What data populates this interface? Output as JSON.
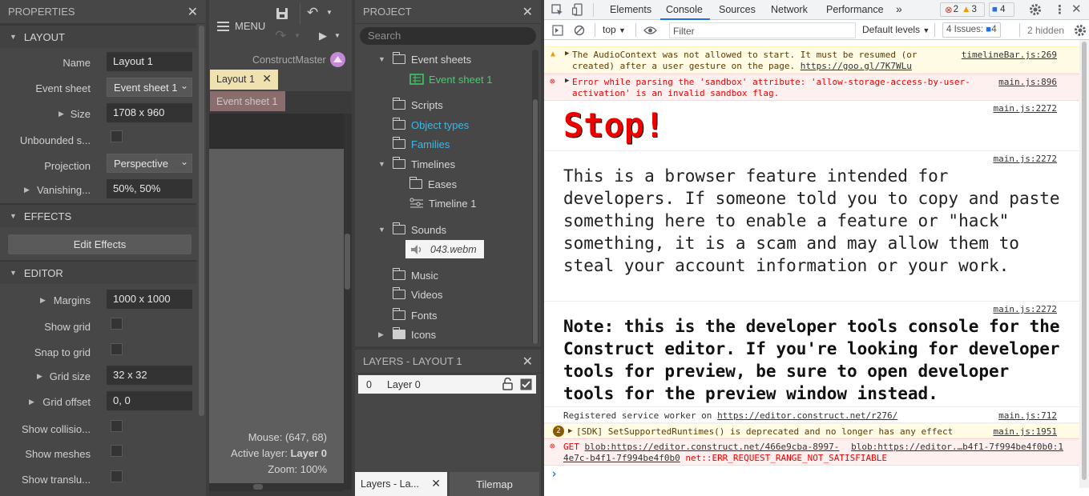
{
  "properties": {
    "title": "PROPERTIES",
    "sections": {
      "layout": "LAYOUT",
      "effects": "EFFECTS",
      "editor": "EDITOR"
    },
    "rows": {
      "name_label": "Name",
      "name_value": "Layout 1",
      "eventsheet_label": "Event sheet",
      "eventsheet_value": "Event sheet 1",
      "size_label": "Size",
      "size_value": "1708 x 960",
      "unbounded_label": "Unbounded s...",
      "projection_label": "Projection",
      "projection_value": "Perspective",
      "vanishing_label": "Vanishing...",
      "vanishing_value": "50%, 50%",
      "edit_effects": "Edit Effects",
      "margins_label": "Margins",
      "margins_value": "1000 x 1000",
      "showgrid_label": "Show grid",
      "snap_label": "Snap to grid",
      "gridsize_label": "Grid size",
      "gridsize_value": "32 x 32",
      "gridoffset_label": "Grid offset",
      "gridoffset_value": "0, 0",
      "collision_label": "Show collisio...",
      "meshes_label": "Show meshes",
      "translu_label": "Show translu..."
    }
  },
  "layoutview": {
    "menu_label": "MENU",
    "user": "ConstructMaster",
    "tab_active": "Layout 1",
    "tab_inactive": "Event sheet 1",
    "mouse": "Mouse: (647, 68)",
    "active_layer_prefix": "Active layer: ",
    "active_layer_value": "Layer 0",
    "zoom": "Zoom: 100%"
  },
  "project": {
    "title": "PROJECT",
    "search_placeholder": "Search",
    "items": {
      "event_sheets": "Event sheets",
      "event_sheet_1": "Event sheet 1",
      "scripts": "Scripts",
      "object_types": "Object types",
      "families": "Families",
      "timelines": "Timelines",
      "eases": "Eases",
      "timeline_1": "Timeline 1",
      "sounds": "Sounds",
      "sound_file": "043.webm",
      "music": "Music",
      "videos": "Videos",
      "fonts": "Fonts",
      "icons": "Icons"
    }
  },
  "layers": {
    "title": "LAYERS - LAYOUT 1",
    "row_index": "0",
    "row_name": "Layer 0",
    "tab_layers": "Layers - La...",
    "tab_tilemap": "Tilemap"
  },
  "devtools": {
    "tabs": {
      "elements": "Elements",
      "console": "Console",
      "sources": "Sources",
      "network": "Network",
      "performance": "Performance",
      "more": "»"
    },
    "badges": {
      "errors": "2",
      "warnings": "3",
      "info": "4"
    },
    "toolbar": {
      "context": "top",
      "filter_placeholder": "Filter",
      "levels": "Default levels",
      "issues_prefix": "4 Issues:",
      "issues_count": "4",
      "hidden": "2 hidden"
    },
    "messages": {
      "warn1_a": "The AudioContext was not allowed to start. It must be resumed (or",
      "warn1_b": "created) after a user gesture on the page.",
      "warn1_link": "https://goo.gl/7K7WLu",
      "warn1_src": "timelineBar.js:269",
      "err1_a": "Error while parsing the 'sandbox' attribute: 'allow-storage-access-by-user-",
      "err1_b": "activation' is an invalid sandbox flag.",
      "err1_src": "main.js:896",
      "stop_src": "main.js:2272",
      "stop": "Stop!",
      "para_src": "main.js:2272",
      "para": "This is a browser feature intended for developers. If someone told you to copy and paste something here to enable a feature or \"hack\" something, it is a scam and may allow them to steal your account information or your work.",
      "note_src": "main.js:2272",
      "note": "Note: this is the developer tools console for the Construct editor. If you're looking for developer tools for preview, be sure to open developer tools for the preview window instead.",
      "sw_text": "Registered service worker on",
      "sw_link": "https://editor.construct.net/r276/",
      "sw_src": "main.js:712",
      "sdk_count": "2",
      "sdk_text": "[SDK] SetSupportedRuntimes() is deprecated and no longer has any effect",
      "sdk_src": "main.js:1951",
      "get_prefix": "GET",
      "get_link1": "blob:https://editor.construct.net/466e9cba-8997-",
      "get_src": "blob:https://editor.…b4f1-7f994be4f0b0:1",
      "get_line2a": "4e7c-b4f1-7f994be4f0b0",
      "get_line2b": "net::ERR_REQUEST_RANGE_NOT_SATISFIABLE",
      "prompt": "›"
    }
  }
}
